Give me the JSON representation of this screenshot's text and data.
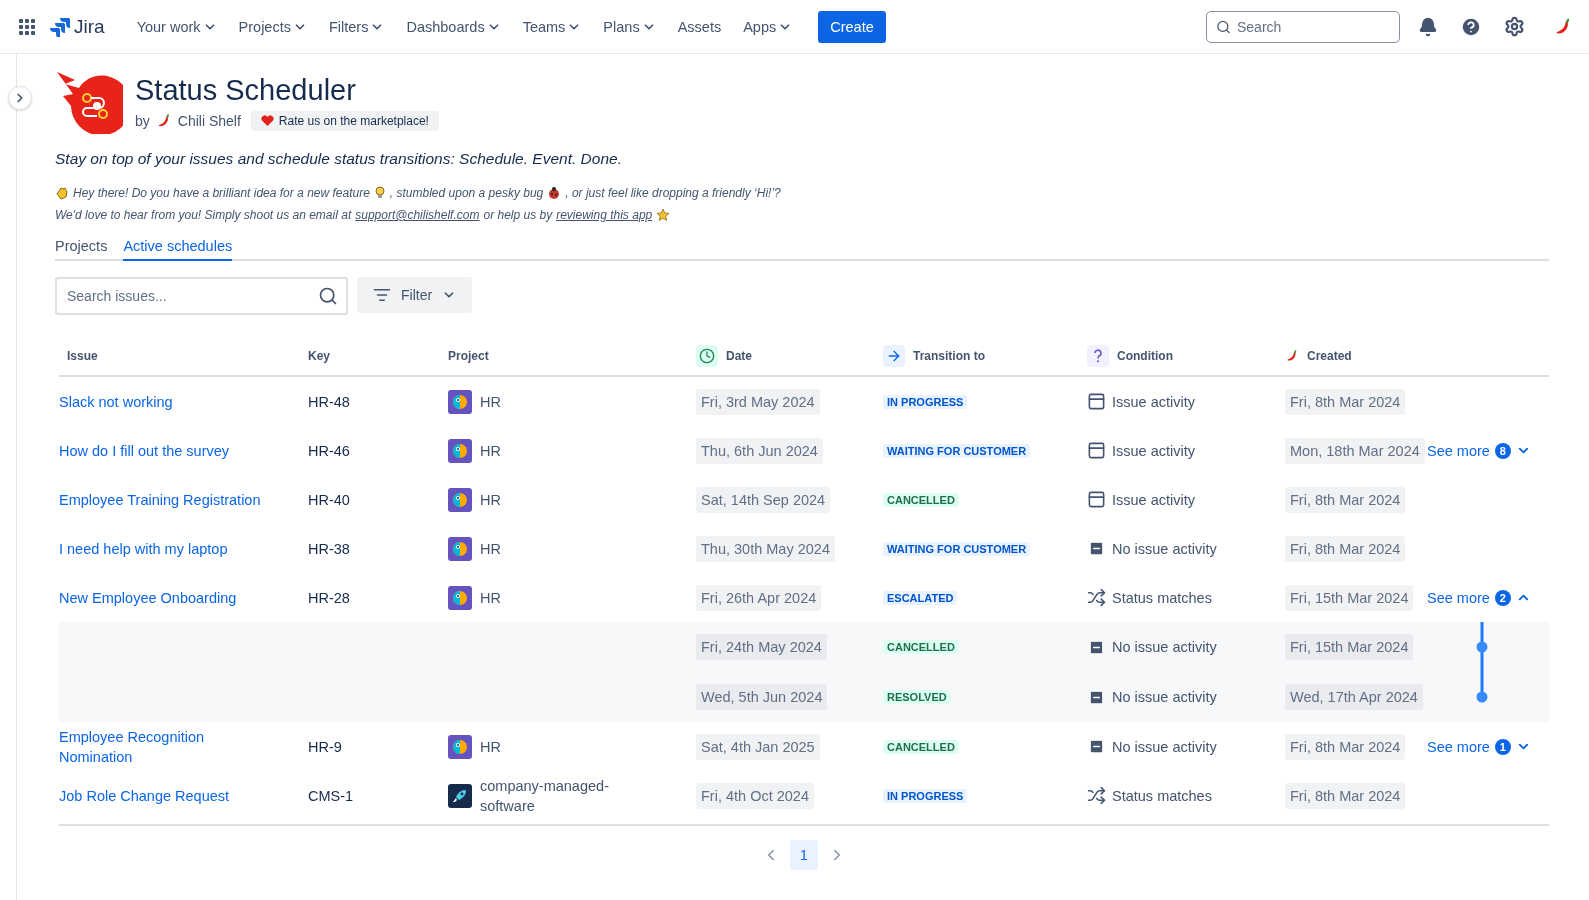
{
  "topnav": {
    "product": "Jira",
    "items": [
      {
        "label": "Your work",
        "dropdown": true
      },
      {
        "label": "Projects",
        "dropdown": true
      },
      {
        "label": "Filters",
        "dropdown": true
      },
      {
        "label": "Dashboards",
        "dropdown": true
      },
      {
        "label": "Teams",
        "dropdown": true
      },
      {
        "label": "Plans",
        "dropdown": true
      },
      {
        "label": "Assets",
        "dropdown": false
      },
      {
        "label": "Apps",
        "dropdown": true
      }
    ],
    "create_button": "Create",
    "search": {
      "placeholder": "Search"
    }
  },
  "app": {
    "title": "Status Scheduler",
    "by": "by",
    "vendor": "Chili Shelf",
    "rate_button": "Rate us on the marketplace!",
    "tagline": "Stay on top of your issues and schedule status transitions: Schedule. Event. Done.",
    "message_lines": [
      [
        {
          "kind": "wave"
        },
        {
          "kind": "text",
          "text": "Hey there! Do you have a brilliant idea for a new feature"
        },
        {
          "kind": "bulb"
        },
        {
          "kind": "text",
          "text": ", stumbled upon a pesky bug"
        },
        {
          "kind": "bug"
        },
        {
          "kind": "text",
          "text": ", or just feel like dropping a friendly ‘Hi!’?"
        }
      ],
      [
        {
          "kind": "text",
          "text": "We'd love to hear from you! Simply shoot us an email at"
        },
        {
          "kind": "link",
          "text": "support@chilishelf.com"
        },
        {
          "kind": "text",
          "text": "or help us by"
        },
        {
          "kind": "link",
          "text": "reviewing this app"
        },
        {
          "kind": "star"
        }
      ]
    ]
  },
  "tabs": [
    {
      "label": "Projects",
      "selected": false
    },
    {
      "label": "Active schedules",
      "selected": true
    }
  ],
  "search": {
    "placeholder": "Search issues..."
  },
  "filter_button": "Filter",
  "table": {
    "columns": [
      {
        "label": "Issue",
        "kind": "plain"
      },
      {
        "label": "Key",
        "kind": "plain"
      },
      {
        "label": "Project",
        "kind": "plain"
      },
      {
        "label": "Date",
        "kind": "clock"
      },
      {
        "label": "Transition to",
        "kind": "arrow"
      },
      {
        "label": "Condition",
        "kind": "question"
      },
      {
        "label": "Created",
        "kind": "chili"
      }
    ],
    "rows": [
      {
        "issue": "Slack not working",
        "key": "HR-48",
        "project": {
          "name": "HR",
          "kind": "parrot"
        },
        "date": "Fri, 3rd May 2024",
        "status": {
          "label": "IN PROGRESS",
          "color": "#0055cc"
        },
        "condition": {
          "label": "Issue activity",
          "kind": "activity"
        },
        "created": "Fri, 8th Mar 2024"
      },
      {
        "issue": "How do I fill out the survey",
        "key": "HR-46",
        "project": {
          "name": "HR",
          "kind": "parrot"
        },
        "date": "Thu, 6th Jun 2024",
        "status": {
          "label": "WAITING FOR CUSTOMER",
          "color": "#0055cc"
        },
        "condition": {
          "label": "Issue activity",
          "kind": "activity"
        },
        "created": "Mon, 18th Mar 2024",
        "see_more": {
          "label": "See more",
          "count": "8",
          "expanded": false
        }
      },
      {
        "issue": "Employee Training Registration",
        "key": "HR-40",
        "project": {
          "name": "HR",
          "kind": "parrot"
        },
        "date": "Sat, 14th Sep 2024",
        "status": {
          "label": "CANCELLED",
          "color": "#216e4e"
        },
        "condition": {
          "label": "Issue activity",
          "kind": "activity"
        },
        "created": "Fri, 8th Mar 2024"
      },
      {
        "issue": "I need help with my laptop",
        "key": "HR-38",
        "project": {
          "name": "HR",
          "kind": "parrot"
        },
        "date": "Thu, 30th May 2024",
        "status": {
          "label": "WAITING FOR CUSTOMER",
          "color": "#0055cc"
        },
        "condition": {
          "label": "No issue activity",
          "kind": "no_activity"
        },
        "created": "Fri, 8th Mar 2024"
      },
      {
        "issue": "New Employee Onboarding",
        "key": "HR-28",
        "project": {
          "name": "HR",
          "kind": "parrot"
        },
        "date": "Fri, 26th Apr 2024",
        "status": {
          "label": "ESCALATED",
          "color": "#0055cc"
        },
        "condition": {
          "label": "Status matches",
          "kind": "status_matches"
        },
        "created": "Fri, 15th Mar 2024",
        "see_more": {
          "label": "See more",
          "count": "2",
          "expanded": true
        },
        "children": [
          {
            "date": "Fri, 24th May 2024",
            "status": {
              "label": "CANCELLED",
              "color": "#216e4e"
            },
            "condition": {
              "label": "No issue activity",
              "kind": "no_activity"
            },
            "created": "Fri, 15th Mar 2024"
          },
          {
            "date": "Wed, 5th Jun 2024",
            "status": {
              "label": "RESOLVED",
              "color": "#216e4e"
            },
            "condition": {
              "label": "No issue activity",
              "kind": "no_activity"
            },
            "created": "Wed, 17th Apr 2024"
          }
        ]
      },
      {
        "issue": "Employee Recognition Nomination",
        "key": "HR-9",
        "project": {
          "name": "HR",
          "kind": "parrot"
        },
        "date": "Sat, 4th Jan 2025",
        "status": {
          "label": "CANCELLED",
          "color": "#216e4e"
        },
        "condition": {
          "label": "No issue activity",
          "kind": "no_activity"
        },
        "created": "Fri, 8th Mar 2024",
        "see_more": {
          "label": "See more",
          "count": "1",
          "expanded": false
        }
      },
      {
        "issue": "Job Role Change Request",
        "key": "CMS-1",
        "project": {
          "name": "company-managed-software",
          "kind": "rocket"
        },
        "date": "Fri, 4th Oct 2024",
        "status": {
          "label": "IN PROGRESS",
          "color": "#0055cc"
        },
        "condition": {
          "label": "Status matches",
          "kind": "status_matches"
        },
        "created": "Fri, 8th Mar 2024"
      }
    ]
  },
  "pagination": {
    "pages": [
      {
        "label": "1",
        "selected": true
      }
    ]
  }
}
